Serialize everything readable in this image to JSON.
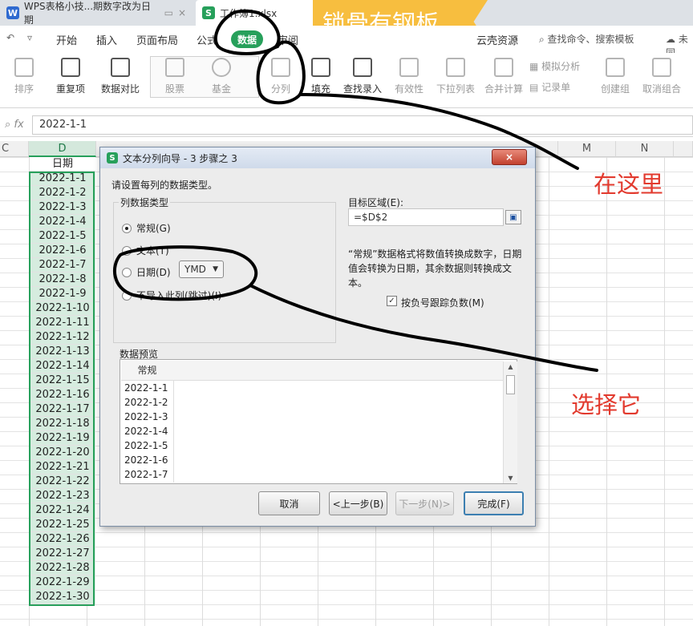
{
  "tabs": [
    {
      "label": "WPS表格小技...期数字改为日期",
      "icon": "W",
      "icon_color": "#2f6ad0"
    },
    {
      "label": "工作簿1.xlsx",
      "icon": "S",
      "icon_color": "#27a05b"
    }
  ],
  "banner": {
    "text": "锁骨有钢板"
  },
  "menu": {
    "items": [
      "开始",
      "插入",
      "页面布局",
      "公式",
      "数据",
      "审阅",
      "云壳资源"
    ],
    "active": "数据",
    "search": "查找命令、搜索模板",
    "cloud": "未同"
  },
  "ribbon": {
    "sort": "排序",
    "dup": "重复项",
    "compare": "数据对比",
    "stock": "股票",
    "fund": "基金",
    "split": "分列",
    "fill": "填充",
    "lookup": "查找录入",
    "valid": "有效性",
    "dropdown": "下拉列表",
    "merge": "合并计算",
    "simulate": "模拟分析",
    "record": "记录单",
    "group": "创建组",
    "ungroup": "取消组合"
  },
  "formula": {
    "fx": "fx",
    "value": "2022-1-1"
  },
  "columns": {
    "c": "C",
    "d": "D",
    "m": "M",
    "n": "N"
  },
  "sheet": {
    "header": "日期",
    "dates": [
      "2022-1-1",
      "2022-1-2",
      "2022-1-3",
      "2022-1-4",
      "2022-1-5",
      "2022-1-6",
      "2022-1-7",
      "2022-1-8",
      "2022-1-9",
      "2022-1-10",
      "2022-1-11",
      "2022-1-12",
      "2022-1-13",
      "2022-1-14",
      "2022-1-15",
      "2022-1-16",
      "2022-1-17",
      "2022-1-18",
      "2022-1-19",
      "2022-1-20",
      "2022-1-21",
      "2022-1-22",
      "2022-1-23",
      "2022-1-24",
      "2022-1-25",
      "2022-1-26",
      "2022-1-27",
      "2022-1-28",
      "2022-1-29",
      "2022-1-30"
    ]
  },
  "dialog": {
    "title": "文本分列向导 - 3 步骤之 3",
    "close": "×",
    "instruction": "请设置每列的数据类型。",
    "group_label": "列数据类型",
    "radio_general": "常规(G)",
    "radio_text": "文本(T)",
    "radio_date": "日期(D)",
    "date_format": "YMD",
    "radio_skip": "不导入此列(跳过)(I)",
    "target_label": "目标区域(E):",
    "target_value": "=$D$2",
    "description": "“常规”数据格式将数值转换成数字，日期值会转换为日期，其余数据则转换成文本。",
    "checkbox_label": "按负号跟踪负数(M)",
    "preview_label": "数据预览",
    "preview_header": "常规",
    "preview_rows": [
      "2022-1-1",
      "2022-1-2",
      "2022-1-3",
      "2022-1-4",
      "2022-1-5",
      "2022-1-6",
      "2022-1-7"
    ],
    "btn_cancel": "取消",
    "btn_back": "<上一步(B)",
    "btn_next": "下一步(N)>",
    "btn_finish": "完成(F)"
  },
  "annotations": {
    "here": "在这里",
    "choose": "选择它"
  }
}
